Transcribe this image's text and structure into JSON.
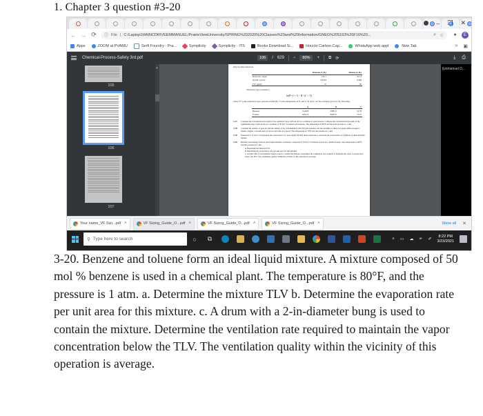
{
  "heading": "1. Chapter 3 question #3-20",
  "question_text": "3-20. Benzene and toluene form an ideal liquid mixture. A mixture composed of 50 mol % benzene is used in a chemical plant. The temperature is 80°F, and the pressure is 1 atm. a. Determine the mixture TLV b. Determine the evaporation rate per unit area for this mixture. c. A drum with a 2-in-diameter bung is used to contain the mixture. Determine the ventilation rate required to maintain the vapor concentration below the TLV. The ventilation quality within the vicinity of this operation is average.",
  "browser": {
    "tabs": [
      {
        "id": "tab1",
        "favicon": "red"
      },
      {
        "id": "tab2",
        "favicon": "gray"
      },
      {
        "id": "tab3",
        "favicon": "gray"
      },
      {
        "id": "tab4",
        "favicon": "gray"
      },
      {
        "id": "tab5",
        "favicon": "gray"
      },
      {
        "id": "tab6",
        "favicon": "sync"
      },
      {
        "id": "tab7",
        "favicon": "sync"
      },
      {
        "id": "tab8",
        "favicon": "sync"
      },
      {
        "id": "tab9",
        "favicon": "orange"
      },
      {
        "id": "tab10",
        "favicon": "pdfred"
      },
      {
        "id": "tab11",
        "favicon": "blue"
      },
      {
        "id": "tab12",
        "favicon": "purple"
      },
      {
        "id": "tab13",
        "favicon": "gray"
      },
      {
        "id": "tab14",
        "favicon": "gray"
      },
      {
        "id": "tab15",
        "favicon": "gray"
      },
      {
        "id": "tab16",
        "favicon": "gray"
      },
      {
        "id": "tab17",
        "favicon": "gray"
      },
      {
        "id": "tab18",
        "favicon": "gray"
      },
      {
        "id": "tab19",
        "favicon": "green"
      },
      {
        "id": "tab20",
        "favicon": "gray"
      },
      {
        "id": "tab21",
        "favicon": "blue"
      },
      {
        "id": "tab22",
        "favicon": "blue"
      },
      {
        "id": "tab23",
        "favicon": "blue"
      },
      {
        "id": "tab24",
        "favicon": "gray"
      },
      {
        "id": "tab25",
        "favicon": "gray"
      },
      {
        "id": "tab26",
        "favicon": "pdfred",
        "active": true
      },
      {
        "id": "tab27",
        "favicon": "gray"
      }
    ],
    "new_tab_label": "+",
    "window_controls": {
      "minimize": "–",
      "maximize": "❐",
      "close": "✕"
    },
    "nav": {
      "back": "←",
      "forward": "→",
      "reload": "⟳"
    },
    "omnibox": {
      "security_label": "File",
      "url": "C:/Laptop1MAINCDRIVEEMMANUEL/PrairieViewUniversity/SPRING%202020%20Classes%20and%20Information/GNEG%205193%20F16%20...",
      "search_icon": "⌕",
      "bookmark_icon": "☆"
    },
    "toolbar_icons": {
      "extensions": "✦",
      "profile_initial": "E"
    },
    "bookmarks": [
      {
        "label": "Apps",
        "icon": "grid"
      },
      {
        "label": "ZOOM at PVAMU",
        "icon": "zoom"
      },
      {
        "label": "Serfi Foundry - Pra...",
        "icon": "doc"
      },
      {
        "label": "Symplicity",
        "icon": "sync"
      },
      {
        "label": "Symplicity - ITS",
        "icon": "sync2"
      },
      {
        "label": "Books Download Si...",
        "icon": "book"
      },
      {
        "label": "Houcto Carbon Cap...",
        "icon": "pdf"
      },
      {
        "label": "WhatsApp web appl",
        "icon": "wa"
      },
      {
        "label": "New Tab",
        "icon": "tab"
      }
    ],
    "bookmarks_overflow": "»",
    "reading_list_icon": "▣"
  },
  "pdf_viewer": {
    "menu_icon": "hamburger-icon",
    "file_name": "Chemical-Process-Safety 3rd.pdf",
    "current_page": "106",
    "page_separator": "/",
    "total_pages": "629",
    "zoom_out": "−",
    "zoom_level": "80%",
    "zoom_in": "+",
    "fit_icon": "⧉",
    "rotate_icon": "⟳",
    "download_icon": "⤓",
    "print_icon": "⎙",
    "thumbnails": [
      {
        "page": "105",
        "selected": false
      },
      {
        "page": "106",
        "selected": true
      },
      {
        "page": "107",
        "selected": false
      }
    ],
    "page_content": {
      "intro_line": "able for these materials:",
      "table": {
        "headers": [
          "",
          "Benzene (C₆H₆)",
          "Toluene (C₇H₈)"
        ],
        "rows": [
          [
            "Molecular weight",
            "78.11",
            "92.13"
          ],
          [
            "Specific gravity",
            "0.8794",
            "0.866"
          ],
          [
            "TLV (ppm)",
            "10",
            "20"
          ]
        ]
      },
      "saturation_label": "Saturation vapor pressures:",
      "equation": "ln(Pˢᵃᵗ) = A − B / (C + T)",
      "where_text": "where Pˢᵃᵗ is the saturation vapor pressure in mm Hg, T is the temperature in K, and A, B, and C are the constants given by the following:",
      "table2": {
        "headers": [
          "",
          "A",
          "B",
          "C"
        ],
        "rows": [
          [
            "Benzene",
            "15.9008",
            "2788.51",
            "−52.36"
          ],
          [
            "Toluene",
            "16.0137",
            "3096.52",
            "−53.67"
          ]
        ]
      },
      "problems": [
        {
          "num": "3-17.",
          "text": "Compute the concentration (in ppm) of the saturated vapor with air above a solution of pure toluene. Compute the concentration (in ppm) of the equilibrium vapor with air above a solution of 50 mol % toluene and benzene. The temperature is 80°F and the total pressure is 1 atm."
        },
        {
          "num": "3-18.",
          "text": "Compute the density of pure air and the density of air contaminated with 100 ppm benzene. Do the densities of these two gases differ enough to ensure a higher concentration on floors and other low spots? The temperature is 70°F and the pressure is 1 atm."
        },
        {
          "num": "3-19.",
          "text": "Equations 3-12 and 3-14 represent the evaporation of a pure liquid. Modify these equations to represent the evaporation of a mixture of ideal miscible liquids."
        },
        {
          "num": "3-20.",
          "text": "Benzene and toluene form an ideal liquid mixture. A mixture composed of 50 mol % benzene is used in a chemical plant. The temperature is 80°F, and the pressure is 1 atm.",
          "subs": [
            {
              "letter": "a.",
              "text": "Determine the mixture TLV."
            },
            {
              "letter": "b.",
              "text": "Determine the evaporation rate per unit area for this mixture."
            },
            {
              "letter": "c.",
              "text": "A drum with a 2-in-diameter bung is used to contain the mixture. Determine the ventilation rate required to maintain the vapor concentration below the TLV. The ventilation quality within the vicinity of this operation is average."
            }
          ]
        }
      ]
    },
    "side_panel_label": "Emmanuel D..."
  },
  "downloads_bar": {
    "items": [
      {
        "label": "Your name_VF Sizi...pdf",
        "chevron": "˄",
        "highlight": false
      },
      {
        "label": "VF Sizing_Guide_O...pdf",
        "chevron": "˄",
        "highlight": true
      },
      {
        "label": "VF Sizing_Guide_O...pdf",
        "chevron": "˄",
        "highlight": false
      },
      {
        "label": "VF Sizing_Guide_O...pdf",
        "chevron": "˄",
        "highlight": false
      }
    ],
    "show_all_label": "Show all",
    "close_label": "✕"
  },
  "taskbar": {
    "start_label": "start-button",
    "search_placeholder": "Type here to search",
    "search_icon": "⚲",
    "apps": [
      {
        "name": "task-view",
        "color": "#c8c8c8",
        "glyph": "○"
      },
      {
        "name": "cortana",
        "color": "#c8c8c8",
        "glyph": "⧉"
      },
      {
        "name": "edge",
        "color": "#0a84c1",
        "glyph": ""
      },
      {
        "name": "store",
        "color": "#d8b24a",
        "glyph": ""
      },
      {
        "name": "chrome-globe",
        "color": "#3a8fd0",
        "glyph": ""
      },
      {
        "name": "mail",
        "color": "#2f6fb5",
        "glyph": ""
      },
      {
        "name": "weather",
        "color": "#6d7a86",
        "glyph": ""
      },
      {
        "name": "file-explorer",
        "color": "#e8b84b",
        "glyph": ""
      },
      {
        "name": "chrome",
        "color": "#e8eaed",
        "glyph": ""
      },
      {
        "name": "word",
        "color": "#2b579a",
        "glyph": ""
      },
      {
        "name": "outlook",
        "color": "#1e5fae",
        "glyph": ""
      },
      {
        "name": "powerpoint",
        "color": "#d04423",
        "glyph": ""
      },
      {
        "name": "excel",
        "color": "#1e7145",
        "glyph": ""
      }
    ],
    "tray": {
      "chevron": "˄",
      "network": "▭",
      "onedrive": "☁",
      "volume": "⦵",
      "pen": "✐",
      "time": "8:22 PM",
      "date": "3/23/2021",
      "notifications": "notification-icon"
    }
  }
}
